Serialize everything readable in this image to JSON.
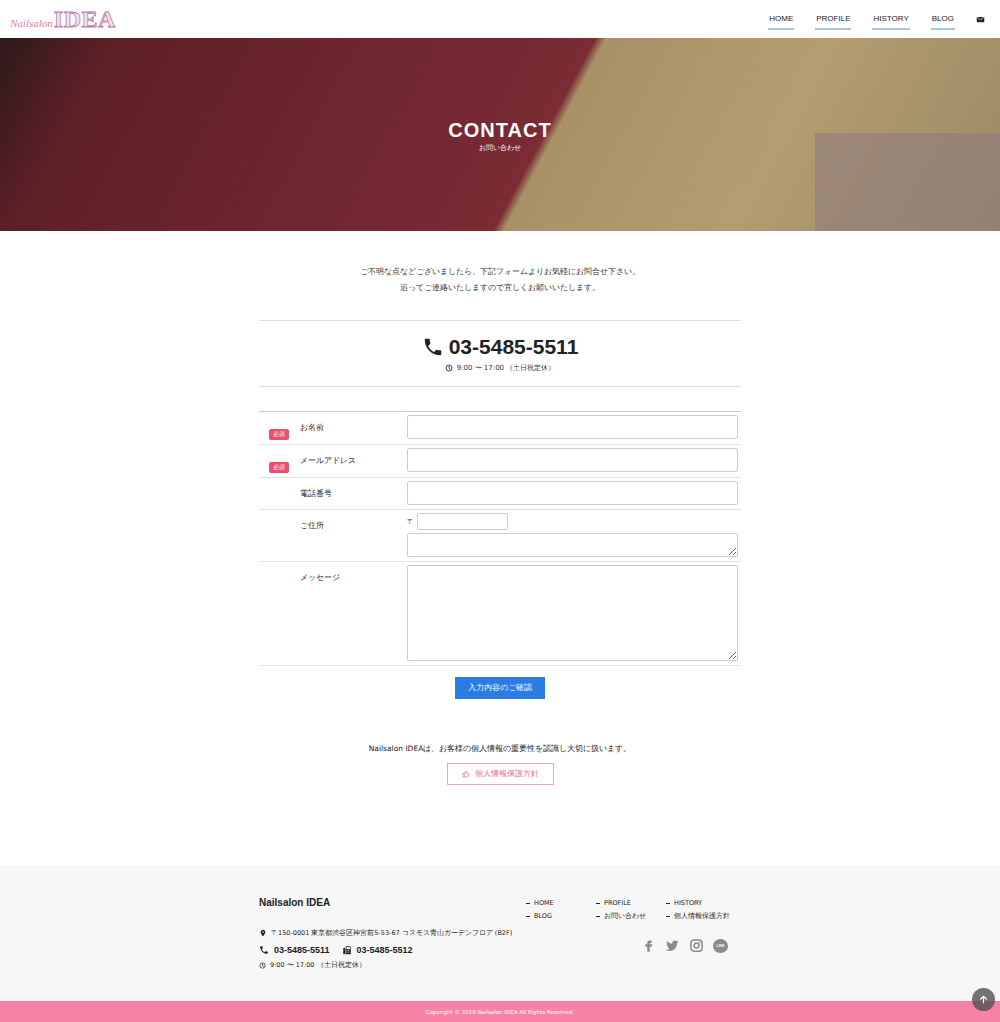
{
  "header": {
    "logo": {
      "script": "Nailsalon",
      "main": "IDEA"
    },
    "nav": [
      {
        "label": "HOME",
        "selected": false
      },
      {
        "label": "PROFILE",
        "selected": false
      },
      {
        "label": "HISTORY",
        "selected": false
      },
      {
        "label": "BLOG",
        "selected": false
      }
    ]
  },
  "hero": {
    "title": "CONTACT",
    "subtitle": "お問い合わせ"
  },
  "intro": [
    "ご不明な点などございましたら、下記フォームよりお気軽にお問合せ下さい。",
    "追ってご連絡いたしますので宜しくお願いいたします。"
  ],
  "phone": {
    "number": "03-5485-5511",
    "hours": "9:00 〜 17:00 （土日祝定休）"
  },
  "form": {
    "fields": [
      {
        "label": "お名前",
        "required": true,
        "badge": "必須",
        "kind": "text",
        "value": ""
      },
      {
        "label": "メールアドレス",
        "required": true,
        "badge": "必須",
        "kind": "text",
        "value": ""
      },
      {
        "label": "電話番号",
        "required": false,
        "kind": "text",
        "value": ""
      },
      {
        "label": "ご住所",
        "required": false,
        "kind": "address",
        "zip_mark": "〒",
        "zip": "",
        "value": ""
      },
      {
        "label": "メッセージ",
        "required": false,
        "kind": "textarea",
        "value": ""
      }
    ],
    "submit": "入力内容のご確認"
  },
  "privacy": {
    "text": "Nailsalon IDEAは、お客様の個人情報の重要性を認識し大切に扱います。",
    "button": "個人情報保護方針"
  },
  "footer": {
    "brand": "Nailsalon IDEA",
    "address": "〒150-0001 東京都渋谷区神宮前5-53-67 コスモス青山ガーデンフロア (B2F)",
    "tel": "03-5485-5511",
    "fax": "03-5485-5512",
    "hours": "9:00 〜 17:00 （土日祝定休）",
    "link_columns": [
      [
        "HOME",
        "BLOG"
      ],
      [
        "PROFILE",
        "お問い合わせ"
      ],
      [
        "HISTORY",
        "個人情報保護方針"
      ]
    ],
    "line_label": "LINE",
    "copyright": "Copyright © 2019 Nailsalon IDEA All Rights Reserved."
  }
}
